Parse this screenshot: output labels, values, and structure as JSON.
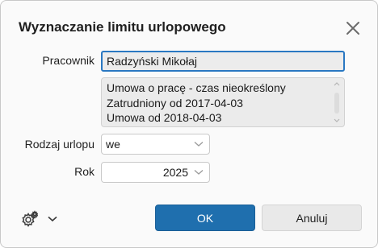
{
  "dialog": {
    "title": "Wyznaczanie limitu urlopowego"
  },
  "form": {
    "employee_label": "Pracownik",
    "employee_value": "Radzyński Mikołaj",
    "info_lines": [
      "Umowa o pracę - czas nieokreślony",
      "Zatrudniony od 2017-04-03",
      "Umowa od 2018-04-03"
    ],
    "leave_type_label": "Rodzaj urlopu",
    "leave_type_value": "we",
    "year_label": "Rok",
    "year_value": "2025"
  },
  "footer": {
    "settings_icon": "gear-icon",
    "ok_label": "OK",
    "cancel_label": "Anuluj"
  },
  "colors": {
    "accent": "#1f6fae",
    "focus_border": "#2a78c2"
  }
}
